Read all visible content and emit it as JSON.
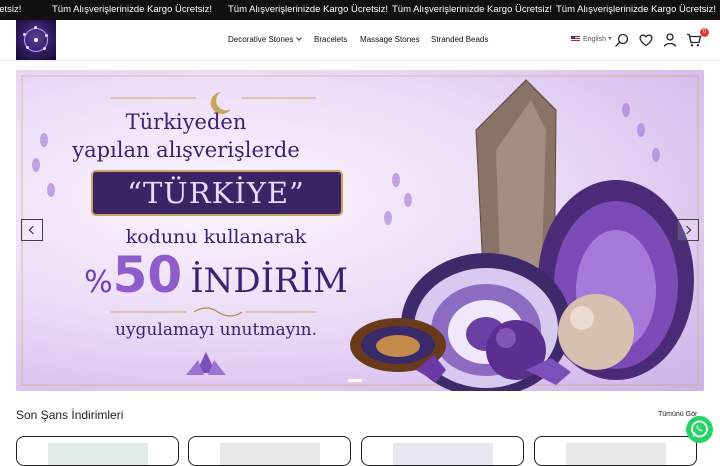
{
  "announcement": {
    "text": "Tüm Alışverişlerinizde Kargo Ücretsiz!",
    "repeat_partial_left": "ücretsiz!"
  },
  "header": {
    "nav": [
      {
        "label": "Decorative Stones",
        "has_dropdown": true
      },
      {
        "label": "Bracelets"
      },
      {
        "label": "Massage Stones"
      },
      {
        "label": "Stranded Beads"
      }
    ],
    "language": "English",
    "cart_count": "0",
    "icons": [
      "search-icon",
      "heart-icon",
      "user-icon",
      "cart-icon"
    ]
  },
  "hero": {
    "line1": "Türkiyeden",
    "line2": "yapılan alışverişlerde",
    "code": "“TÜRKİYE”",
    "use_code": "kodunu kullanarak",
    "discount_pct": "%",
    "discount_value": "50",
    "discount_word": "İNDİRİM",
    "remember": "uygulamayı unutmayın.",
    "slide_index": 2,
    "slide_count": 3
  },
  "section": {
    "title": "Son Şans İndirimleri",
    "see_all": "Tümünü Gör"
  },
  "colors": {
    "announcement_bg": "#111111",
    "accent_purple": "#3b2270",
    "badge_red": "#e53935",
    "whatsapp_green": "#25d366"
  }
}
